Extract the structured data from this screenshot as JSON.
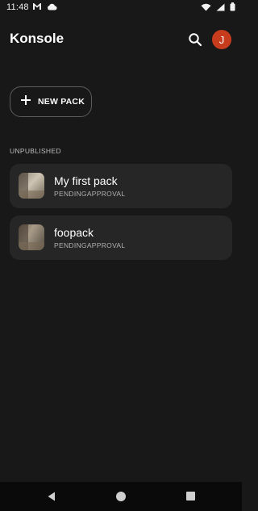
{
  "status_bar": {
    "time": "11:48",
    "left_icons": [
      "gmail-icon",
      "cloud-icon"
    ],
    "right_icons": [
      "wifi-icon",
      "signal-icon",
      "battery-icon"
    ]
  },
  "app_bar": {
    "title": "Konsole",
    "search_icon": "search-icon",
    "avatar_initial": "J",
    "avatar_color": "#c83c1e"
  },
  "actions": {
    "new_pack_label": "NEW PACK",
    "new_pack_icon": "plus-icon"
  },
  "sections": [
    {
      "header": "UNPUBLISHED",
      "packs": [
        {
          "name": "My first pack",
          "status": "PENDINGAPPROVAL"
        },
        {
          "name": "foopack",
          "status": "PENDINGAPPROVAL"
        }
      ]
    }
  ],
  "nav_bar": {
    "icons": [
      "back-icon",
      "home-icon",
      "recents-icon"
    ]
  },
  "colors": {
    "background": "#181818",
    "card": "#262626",
    "accent": "#c83c1e"
  }
}
